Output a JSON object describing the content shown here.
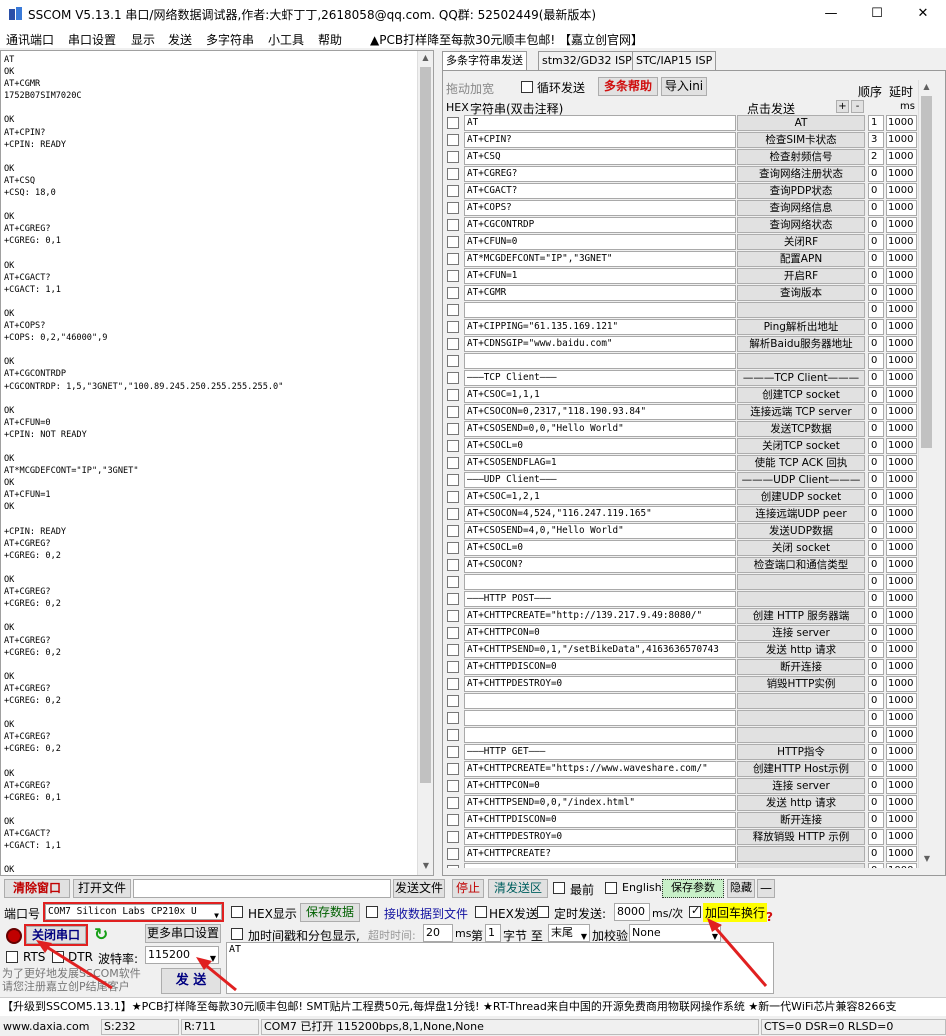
{
  "window": {
    "title": "SSCOM V5.13.1 串口/网络数据调试器,作者:大虾丁丁,2618058@qq.com. QQ群: 52502449(最新版本)",
    "minimize": "—",
    "maximize": "☐",
    "close": "✕"
  },
  "menu": {
    "items": [
      "通讯端口",
      "串口设置",
      "显示",
      "发送",
      "多字符串",
      "小工具",
      "帮助"
    ],
    "promo": "▲PCB打样降至每款30元顺丰包邮! 【嘉立创官网】"
  },
  "receive": {
    "text": "AT\nOK\nAT+CGMR\n1752B07SIM7020C\n\nOK\nAT+CPIN?\n+CPIN: READY\n\nOK\nAT+CSQ\n+CSQ: 18,0\n\nOK\nAT+CGREG?\n+CGREG: 0,1\n\nOK\nAT+CGACT?\n+CGACT: 1,1\n\nOK\nAT+COPS?\n+COPS: 0,2,\"46000\",9\n\nOK\nAT+CGCONTRDP\n+CGCONTRDP: 1,5,\"3GNET\",\"100.89.245.250.255.255.255.0\"\n\nOK\nAT+CFUN=0\n+CPIN: NOT READY\n\nOK\nAT*MCGDEFCONT=\"IP\",\"3GNET\"\nOK\nAT+CFUN=1\nOK\n\n+CPIN: READY\nAT+CGREG?\n+CGREG: 0,2\n\nOK\nAT+CGREG?\n+CGREG: 0,2\n\nOK\nAT+CGREG?\n+CGREG: 0,2\n\nOK\nAT+CGREG?\n+CGREG: 0,2\n\nOK\nAT+CGREG?\n+CGREG: 0,2\n\nOK\nAT+CGREG?\n+CGREG: 0,1\n\nOK\nAT+CGACT?\n+CGACT: 1,1\n\nOK"
  },
  "tabs": [
    "多条字符串发送",
    "stm32/GD32 ISP",
    "STC/IAP15 ISP"
  ],
  "multi": {
    "drag_label": "拖动加宽",
    "loop_label": "循环发送",
    "help_label": "多条帮助",
    "import_label": "导入ini",
    "order_label": "顺序",
    "delay_label": "延时",
    "hex_header": "HEX",
    "string_header": "字符串(双击注释)",
    "click_header": "点击发送",
    "plus": "+",
    "minus": "-",
    "ms_label": "ms",
    "rows": [
      {
        "cmd": "AT",
        "btn": "AT",
        "order": "1",
        "delay": "1000"
      },
      {
        "cmd": "AT+CPIN?",
        "btn": "检查SIM卡状态",
        "order": "3",
        "delay": "1000"
      },
      {
        "cmd": "AT+CSQ",
        "btn": "检查射频信号",
        "order": "2",
        "delay": "1000"
      },
      {
        "cmd": "AT+CGREG?",
        "btn": "查询网络注册状态",
        "order": "0",
        "delay": "1000"
      },
      {
        "cmd": "AT+CGACT?",
        "btn": "查询PDP状态",
        "order": "0",
        "delay": "1000"
      },
      {
        "cmd": "AT+COPS?",
        "btn": "查询网络信息",
        "order": "0",
        "delay": "1000"
      },
      {
        "cmd": "AT+CGCONTRDP",
        "btn": "查询网络状态",
        "order": "0",
        "delay": "1000"
      },
      {
        "cmd": "AT+CFUN=0",
        "btn": "关闭RF",
        "order": "0",
        "delay": "1000"
      },
      {
        "cmd": "AT*MCGDEFCONT=\"IP\",\"3GNET\"",
        "btn": "配置APN",
        "order": "0",
        "delay": "1000"
      },
      {
        "cmd": "AT+CFUN=1",
        "btn": "开启RF",
        "order": "0",
        "delay": "1000"
      },
      {
        "cmd": "AT+CGMR",
        "btn": "查询版本",
        "order": "0",
        "delay": "1000"
      },
      {
        "cmd": "",
        "btn": "",
        "order": "0",
        "delay": "1000"
      },
      {
        "cmd": "AT+CIPPING=\"61.135.169.121\"",
        "btn": "Ping解析出地址",
        "order": "0",
        "delay": "1000"
      },
      {
        "cmd": "AT+CDNSGIP=\"www.baidu.com\"",
        "btn": "解析Baidu服务器地址",
        "order": "0",
        "delay": "1000"
      },
      {
        "cmd": "",
        "btn": "",
        "order": "0",
        "delay": "1000"
      },
      {
        "cmd": "———TCP Client———",
        "btn": "———TCP Client———",
        "order": "0",
        "delay": "1000"
      },
      {
        "cmd": "AT+CSOC=1,1,1",
        "btn": "创建TCP socket",
        "order": "0",
        "delay": "1000"
      },
      {
        "cmd": "AT+CSOCON=0,2317,\"118.190.93.84\"",
        "btn": "连接远端 TCP server",
        "order": "0",
        "delay": "1000"
      },
      {
        "cmd": "AT+CSOSEND=0,0,\"Hello World\"",
        "btn": "发送TCP数据",
        "order": "0",
        "delay": "1000"
      },
      {
        "cmd": "AT+CSOCL=0",
        "btn": "关闭TCP socket",
        "order": "0",
        "delay": "1000"
      },
      {
        "cmd": "AT+CSOSENDFLAG=1",
        "btn": "使能 TCP ACK 回执",
        "order": "0",
        "delay": "1000"
      },
      {
        "cmd": "———UDP Client———",
        "btn": "———UDP Client———",
        "order": "0",
        "delay": "1000"
      },
      {
        "cmd": "AT+CSOC=1,2,1",
        "btn": "创建UDP socket",
        "order": "0",
        "delay": "1000"
      },
      {
        "cmd": "AT+CSOCON=4,524,\"116.247.119.165\"",
        "btn": "连接远端UDP peer",
        "order": "0",
        "delay": "1000"
      },
      {
        "cmd": "AT+CSOSEND=4,0,\"Hello World\"",
        "btn": "发送UDP数据",
        "order": "0",
        "delay": "1000"
      },
      {
        "cmd": "AT+CSOCL=0",
        "btn": "关闭 socket",
        "order": "0",
        "delay": "1000"
      },
      {
        "cmd": "AT+CSOCON?",
        "btn": "检查端口和通信类型",
        "order": "0",
        "delay": "1000"
      },
      {
        "cmd": "",
        "btn": "",
        "order": "0",
        "delay": "1000"
      },
      {
        "cmd": "———HTTP POST———",
        "btn": "",
        "order": "0",
        "delay": "1000"
      },
      {
        "cmd": "AT+CHTTPCREATE=\"http://139.217.9.49:8080/\"",
        "btn": "创建 HTTP 服务器端",
        "order": "0",
        "delay": "1000"
      },
      {
        "cmd": "AT+CHTTPCON=0",
        "btn": "连接 server",
        "order": "0",
        "delay": "1000"
      },
      {
        "cmd": "AT+CHTTPSEND=0,1,\"/setBikeData\",4163636570743",
        "btn": "发送 http 请求",
        "order": "0",
        "delay": "1000"
      },
      {
        "cmd": "AT+CHTTPDISCON=0",
        "btn": "断开连接",
        "order": "0",
        "delay": "1000"
      },
      {
        "cmd": "AT+CHTTPDESTROY=0",
        "btn": "销毁HTTP实例",
        "order": "0",
        "delay": "1000"
      },
      {
        "cmd": "",
        "btn": "",
        "order": "0",
        "delay": "1000"
      },
      {
        "cmd": "",
        "btn": "",
        "order": "0",
        "delay": "1000"
      },
      {
        "cmd": "",
        "btn": "",
        "order": "0",
        "delay": "1000"
      },
      {
        "cmd": "———HTTP GET———",
        "btn": "HTTP指令",
        "order": "0",
        "delay": "1000"
      },
      {
        "cmd": "AT+CHTTPCREATE=\"https://www.waveshare.com/\"",
        "btn": "创建HTTP Host示例",
        "order": "0",
        "delay": "1000"
      },
      {
        "cmd": "AT+CHTTPCON=0",
        "btn": "连接 server",
        "order": "0",
        "delay": "1000"
      },
      {
        "cmd": "AT+CHTTPSEND=0,0,\"/index.html\"",
        "btn": "发送 http 请求",
        "order": "0",
        "delay": "1000"
      },
      {
        "cmd": "AT+CHTTPDISCON=0",
        "btn": "断开连接",
        "order": "0",
        "delay": "1000"
      },
      {
        "cmd": "AT+CHTTPDESTROY=0",
        "btn": "释放销毁 HTTP 示例",
        "order": "0",
        "delay": "1000"
      },
      {
        "cmd": "AT+CHTTPCREATE?",
        "btn": "",
        "order": "0",
        "delay": "1000"
      },
      {
        "cmd": "",
        "btn": "",
        "order": "0",
        "delay": "1000"
      }
    ]
  },
  "toolbar": {
    "clear_window": "清除窗口",
    "open_file": "打开文件",
    "send_file": "发送文件",
    "stop": "停止",
    "clear_send": "清发送区",
    "topmost": "最前",
    "english": "English",
    "save_params": "保存参数",
    "hide": "隐藏",
    "dash": "—"
  },
  "port": {
    "label": "端口号",
    "value": "COM7 Silicon Labs CP210x U",
    "hex_display": "HEX显示",
    "save_data": "保存数据",
    "recv_to_file": "接收数据到文件",
    "hex_send": "HEX发送",
    "timed_send": "定时发送:",
    "interval": "8000",
    "interval_unit": "ms/次",
    "add_crlf": "加回车换行",
    "more_settings": "更多串口设置",
    "close_port": "关闭串口",
    "timestamp": "加时间戳和分包显示,",
    "timeout_label": "超时时间:",
    "timeout": "20",
    "ms": "ms",
    "nth": "第",
    "byte_num": "1",
    "byte_label": "字节 至",
    "tail": "末尾",
    "checksum_label": "加校验",
    "checksum": "None",
    "rts": "RTS",
    "dtr": "DTR",
    "baud_label": "波特率:",
    "baud": "115200",
    "send_text": "AT",
    "promo": "为了更好地发展SSCOM软件\n请您注册嘉立创P结尾客户",
    "send_button": "发 送"
  },
  "ticker": "【升级到SSCOM5.13.1】★PCB打样降至每款30元顺丰包邮! SMT贴片工程费50元,每焊盘1分钱! ★RT-Thread来自中国的开源免费商用物联网操作系统 ★新一代WiFi芯片兼容8266支",
  "status": {
    "url": "www.daxia.com",
    "sent": "S:232",
    "recv": "R:711",
    "port_state": "COM7 已打开  115200bps,8,1,None,None",
    "lines": "CTS=0 DSR=0 RLSD=0"
  },
  "colors": {
    "red_highlight": "#e02020",
    "help_red": "#d01010",
    "crlf_yellow": "#ffff00",
    "save_green": "#c8f0c8"
  }
}
